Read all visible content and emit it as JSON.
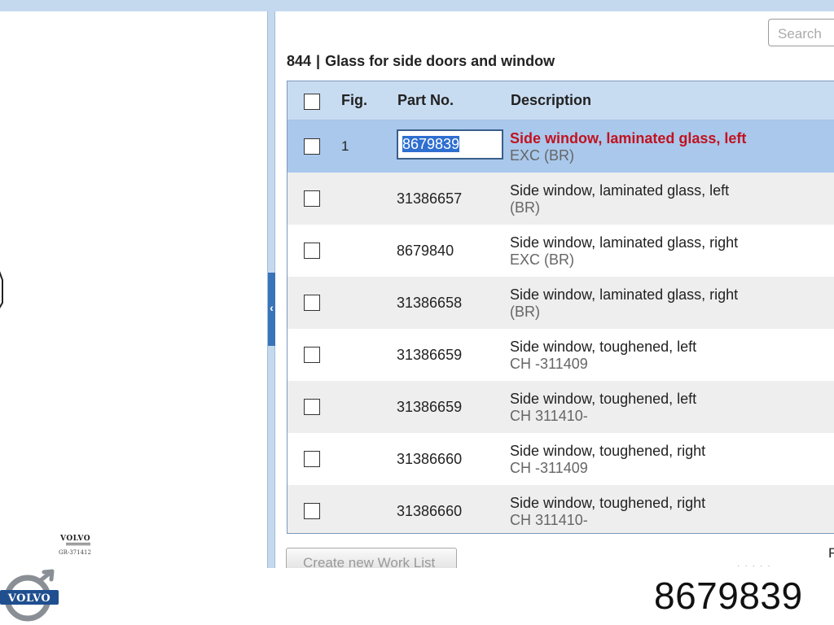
{
  "search": {
    "placeholder": "Search"
  },
  "header": {
    "code": "844",
    "separator": "|",
    "title": "Glass for side doors and window"
  },
  "diagram": {
    "brand_stamp": "VOLVO",
    "drawing_code": "GR-371412"
  },
  "table": {
    "columns": {
      "fig": "Fig.",
      "part_no": "Part No.",
      "description": "Description"
    },
    "rows": [
      {
        "fig": "1",
        "part_no": "8679839",
        "description": "Side window, laminated glass, left",
        "note": "EXC (BR)",
        "selected": true
      },
      {
        "fig": "",
        "part_no": "31386657",
        "description": "Side window, laminated glass, left",
        "note": "(BR)"
      },
      {
        "fig": "",
        "part_no": "8679840",
        "description": "Side window, laminated glass, right",
        "note": "EXC (BR)"
      },
      {
        "fig": "",
        "part_no": "31386658",
        "description": "Side window, laminated glass, right",
        "note": "(BR)"
      },
      {
        "fig": "",
        "part_no": "31386659",
        "description": "Side window, toughened, left",
        "note": "CH -311409"
      },
      {
        "fig": "",
        "part_no": "31386659",
        "description": "Side window, toughened, left",
        "note": "CH 311410-"
      },
      {
        "fig": "",
        "part_no": "31386660",
        "description": "Side window, toughened, right",
        "note": "CH -311409"
      },
      {
        "fig": "",
        "part_no": "31386660",
        "description": "Side window, toughened, right",
        "note": "CH 311410-"
      }
    ]
  },
  "actions": {
    "create_worklist": "Create new Work List"
  },
  "edge_text": "F",
  "footer": {
    "logo_text": "VOLVO",
    "part_number": "8679839"
  },
  "colors": {
    "header_bg": "#c8dcf1",
    "selected_row": "#a9c8ec",
    "highlight_text": "#c2121f",
    "divider_tab": "#3a74b8"
  }
}
